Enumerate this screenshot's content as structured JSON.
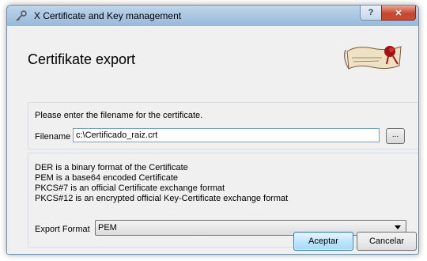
{
  "window": {
    "title": "X Certificate and Key management"
  },
  "titlebar": {
    "help_label": "?",
    "close_label": "✕"
  },
  "header": {
    "heading": "Certifikate export"
  },
  "filename_group": {
    "prompt": "Please enter the filename for the certificate.",
    "label": "Filename",
    "value": "c:\\Certificado_raiz.crt",
    "browse_label": "..."
  },
  "format_group": {
    "descriptions": [
      "DER is a binary format of the Certificate",
      "PEM is a base64 encoded Certificate",
      "PKCS#7 is an official Certificate exchange format",
      "PKCS#12 is an encrypted official Key-Certificate exchange format"
    ],
    "export_label": "Export Format",
    "selected": "PEM"
  },
  "buttons": {
    "ok": "Aceptar",
    "cancel": "Cancelar"
  },
  "colors": {
    "titlebar": "#a9c5e2",
    "close": "#c7452d",
    "accent_button": "#bee6fd"
  },
  "icons": {
    "app": "key-icon",
    "logo": "scroll-logo"
  }
}
